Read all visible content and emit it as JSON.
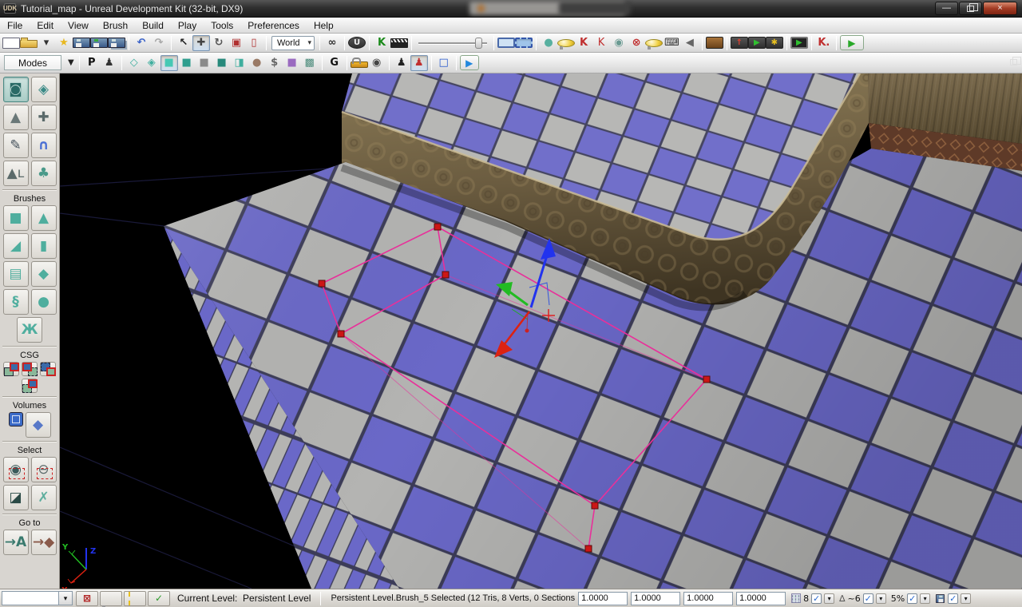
{
  "window": {
    "title": "Tutorial_map - Unreal Development Kit (32-bit, DX9)",
    "badge": "UDK",
    "minimize_glyph": "—",
    "close_glyph": "×"
  },
  "menu": {
    "items": [
      "File",
      "Edit",
      "View",
      "Brush",
      "Build",
      "Play",
      "Tools",
      "Preferences",
      "Help"
    ]
  },
  "toolbar_main": {
    "world_label": "World",
    "groups": [
      [
        {
          "name": "new-map-button",
          "cls": "ic-page"
        },
        {
          "name": "open-map-button",
          "cls": "ic-folder"
        },
        {
          "name": "open-dropdown-arrow",
          "glyph": "▾",
          "color": "#333"
        },
        {
          "name": "favorites-star-icon",
          "glyph": "★",
          "color": "#e8b820"
        },
        {
          "name": "save-button",
          "cls": "ic-floppy"
        },
        {
          "name": "save-as-button",
          "cls": "ic-floppy fl-green"
        },
        {
          "name": "save-all-button",
          "cls": "ic-floppy fl-all"
        }
      ],
      [
        {
          "name": "undo-button",
          "glyph": "↶",
          "color": "#3a62c8",
          "bold": true
        },
        {
          "name": "redo-button",
          "glyph": "↷",
          "color": "#a8a8a8",
          "bold": true
        }
      ],
      [
        {
          "name": "select-tool",
          "glyph": "↖",
          "color": "#222",
          "bold": true
        },
        {
          "name": "translate-tool",
          "glyph": "✚",
          "color": "#444",
          "pressed": true
        },
        {
          "name": "rotate-tool",
          "glyph": "↻",
          "color": "#555",
          "bold": true
        },
        {
          "name": "scale-tool",
          "glyph": "▣",
          "color": "#b03030"
        },
        {
          "name": "scale-nonuniform-tool",
          "glyph": "▯",
          "color": "#b03030"
        }
      ],
      [
        {
          "name": "world-coord-select",
          "widget": "select"
        }
      ],
      [
        {
          "name": "find-actors-button",
          "glyph": "∞",
          "color": "#333",
          "bold": true
        }
      ],
      [
        {
          "name": "content-browser-button",
          "glyph": "U",
          "cls": "chip round"
        }
      ],
      [
        {
          "name": "kismet-button",
          "glyph": "K",
          "color": "#1a8a1a",
          "bold": true
        },
        {
          "name": "matinee-button",
          "cls": "ic-clapper"
        }
      ],
      [
        {
          "name": "camera-speed-slider",
          "widget": "slider"
        }
      ],
      [
        {
          "name": "brush-wireframe-toggle",
          "cls": "ic-bsq"
        },
        {
          "name": "brush-marker-toggle",
          "cls": "ic-bsq dashed",
          "pressed": true
        }
      ],
      [
        {
          "name": "sphere-toggle",
          "glyph": "●",
          "color": "#58b0a0"
        },
        {
          "name": "light-toggle",
          "cls": "ic-bulb"
        },
        {
          "name": "socket-snap-icon",
          "glyph": "K",
          "color": "#c03030",
          "bold": true
        },
        {
          "name": "socket-snap-alt-icon",
          "glyph": "K",
          "color": "#c03030"
        },
        {
          "name": "spheres-toggle",
          "glyph": "◉",
          "color": "#6a9a92"
        },
        {
          "name": "kill-lights-toggle",
          "glyph": "⊗",
          "color": "#c03030",
          "bold": true
        },
        {
          "name": "bulb-m-toggle",
          "cls": "ic-bulb"
        },
        {
          "name": "remote-keyboard-toggle",
          "glyph": "⌨",
          "color": "#333"
        },
        {
          "name": "audio-toggle",
          "glyph": "◀",
          "color": "#666"
        }
      ],
      [
        {
          "name": "build-geometry-button",
          "cls": "chip brown"
        }
      ],
      [
        {
          "name": "deploy-device-button",
          "glyph": "↑",
          "cls": "chip",
          "color": "#e04030",
          "bold": true
        },
        {
          "name": "play-on-device-button",
          "glyph": "▶",
          "cls": "chip",
          "color": "#30c030"
        },
        {
          "name": "device-settings-button",
          "glyph": "✱",
          "cls": "chip",
          "color": "#e8c020"
        }
      ],
      [
        {
          "name": "play-in-viewport-button",
          "glyph": "▶",
          "cls": "chip screen",
          "color": "#30c030"
        }
      ],
      [
        {
          "name": "kismet-debug-button",
          "glyph": "K.",
          "color": "#c03030",
          "bold": true
        }
      ],
      [
        {
          "name": "play-button",
          "glyph": "▶",
          "cls": "playbox",
          "color": "#28a828"
        }
      ]
    ]
  },
  "toolbar_modes": {
    "label": "Modes",
    "caption_arrow": "▼",
    "restore_name": "restore-panes-button",
    "items": [
      {
        "name": "perspective-toggle",
        "glyph": "P",
        "bold": true,
        "color": "#111"
      },
      {
        "name": "camera-pawn-toggle",
        "glyph": "♟",
        "color": "#333"
      },
      {
        "sep": true
      },
      {
        "name": "view-wireframe-icon",
        "glyph": "◇",
        "color": "#3fae9e"
      },
      {
        "name": "view-brushwire-icon",
        "glyph": "◈",
        "color": "#3fae9e"
      },
      {
        "name": "view-unlit-icon",
        "glyph": "■",
        "color": "#46c8b4",
        "pressed": true
      },
      {
        "name": "view-lit-icon",
        "glyph": "■",
        "color": "#2f9e8e"
      },
      {
        "name": "view-detail-lighting-icon",
        "glyph": "■",
        "color": "#8a8a8a"
      },
      {
        "name": "view-lighting-only-icon",
        "glyph": "■",
        "color": "#27897b"
      },
      {
        "name": "view-texture-density-icon",
        "glyph": "◨",
        "color": "#3fae9e"
      },
      {
        "name": "view-shader-complexity-icon",
        "glyph": "●",
        "color": "#9a7a66"
      },
      {
        "name": "view-cost-icon",
        "glyph": "$",
        "color": "#666",
        "bold": true
      },
      {
        "name": "view-lightmap-density-icon",
        "glyph": "■",
        "color": "#9a6ac0"
      },
      {
        "name": "view-reflections-icon",
        "glyph": "▩",
        "color": "#4a8a7a"
      },
      {
        "sep": true
      },
      {
        "name": "game-view-toggle",
        "glyph": "G",
        "bold": true,
        "color": "#111"
      },
      {
        "sep": true
      },
      {
        "name": "lock-viewport-button",
        "cls": "ic-lock"
      },
      {
        "name": "show-flags-eye-icon",
        "glyph": "◉",
        "color": "#444"
      },
      {
        "sep": true
      },
      {
        "name": "possess-pawn-button",
        "glyph": "♟",
        "color": "#222"
      },
      {
        "name": "possess-pawn-red-button",
        "glyph": "♟",
        "color": "#c03030",
        "pressed": true
      },
      {
        "sep": true
      },
      {
        "name": "maximize-viewport-toggle",
        "glyph": "□",
        "color": "#2255cc",
        "bold": true
      },
      {
        "sep": true
      },
      {
        "name": "realtime-play-button",
        "glyph": "▶",
        "cls": "playbox sm",
        "color": "#2288dd"
      }
    ]
  },
  "sidebar": {
    "sections": [
      {
        "items": [
          {
            "name": "mode-camera",
            "glyph": "◙",
            "color": "#2a6a66",
            "selected": true
          },
          {
            "name": "mode-geometry",
            "glyph": "◈",
            "color": "#3a8a86"
          },
          {
            "name": "mode-terrain",
            "glyph": "▲",
            "color": "#6a7878"
          },
          {
            "name": "mode-texture-align",
            "glyph": "✚",
            "color": "#5a6a6a"
          },
          {
            "name": "mode-geometry-edit",
            "glyph": "✎",
            "color": "#44505a"
          },
          {
            "name": "mode-static-mesh",
            "glyph": "∩",
            "color": "#4a6fd4",
            "bold": true
          },
          {
            "name": "mode-landscape",
            "glyph": "▲ʟ",
            "color": "#5a6a6a"
          },
          {
            "name": "mode-foliage",
            "glyph": "♣",
            "color": "#4a9a8a"
          }
        ]
      },
      {
        "label": "Brushes",
        "items": [
          {
            "name": "brush-cube",
            "glyph": "■",
            "color": "#4fae9e"
          },
          {
            "name": "brush-cone",
            "glyph": "▲",
            "color": "#4fae9e"
          },
          {
            "name": "brush-curved-stairs",
            "glyph": "◢",
            "color": "#4fae9e"
          },
          {
            "name": "brush-cylinder",
            "glyph": "▮",
            "color": "#4fae9e"
          },
          {
            "name": "brush-stairs",
            "glyph": "▤",
            "color": "#4fae9e"
          },
          {
            "name": "brush-sheet",
            "glyph": "◆",
            "color": "#4fae9e"
          },
          {
            "name": "brush-spiral-stairs",
            "glyph": "§",
            "color": "#4fae9e",
            "bold": true
          },
          {
            "name": "brush-sphere",
            "glyph": "●",
            "color": "#4fae9e"
          },
          {
            "name": "brush-volumetric",
            "glyph": "Ж",
            "color": "#4fae9e",
            "bold": true
          }
        ]
      },
      {
        "label": "CSG",
        "items": [
          {
            "name": "csg-add-button",
            "cls": "ic-csg csg-add"
          },
          {
            "name": "csg-subtract-button",
            "cls": "ic-csg csg-sub"
          },
          {
            "name": "csg-intersect-button",
            "cls": "ic-csg csg-int"
          },
          {
            "name": "csg-deintersect-button",
            "cls": "ic-csg csg-deint"
          }
        ]
      },
      {
        "label": "Volumes",
        "items": [
          {
            "name": "volume-box-button",
            "cls": "ic-volbox"
          },
          {
            "name": "volume-sphere-button",
            "glyph": "◆",
            "color": "#5878c8"
          }
        ]
      },
      {
        "label": "Select",
        "items": [
          {
            "name": "select-show-button",
            "glyph": "◉",
            "color": "#3a5a5a",
            "cls": "redbox"
          },
          {
            "name": "select-hide-button",
            "glyph": "⊖",
            "color": "#5a6a6a",
            "cls": "redbox"
          },
          {
            "name": "select-invert-button",
            "glyph": "◪",
            "color": "#2a4a46"
          },
          {
            "name": "select-none-button",
            "glyph": "✗",
            "color": "#5fae9e",
            "bold": true
          }
        ]
      },
      {
        "label": "Go to",
        "items": [
          {
            "name": "goto-actor-button",
            "glyph": "→A",
            "color": "#3a7a6e",
            "bold": true
          },
          {
            "name": "goto-builder-brush-button",
            "glyph": "→◆",
            "color": "#8a5a4a",
            "bold": true
          }
        ]
      }
    ]
  },
  "viewport": {
    "colors": {
      "checker_blue": "#6a68c8",
      "checker_gray": "#b4b4b2",
      "checker_grout": "#3c3c58",
      "selection_pink": "#e8309a",
      "vertex_red": "#cc1616",
      "axis_x_red": "#dd2211",
      "axis_y_green": "#22bb22",
      "axis_z_blue": "#2233ee",
      "grid_line": "#191938",
      "trim_brown": "#77674a",
      "wall_wood": "#6b5d42",
      "band_red": "#5e3a28"
    },
    "axis_labels": {
      "x": "X",
      "y": "Y",
      "z": "Z"
    },
    "selected_brush": "Brush_5"
  },
  "status_bar": {
    "dropdown_arrow": "▾",
    "buttons": [
      {
        "name": "hide-builder-brush-button",
        "glyph": "⊠",
        "color": "#b02020",
        "bold": true
      },
      {
        "name": "bulb-status-button",
        "cls": "ic-bulb"
      },
      {
        "name": "paths-status-button",
        "cls": "ic-road"
      },
      {
        "name": "package-check-button",
        "glyph": "✓",
        "color": "#2a9a2a",
        "bold": true
      }
    ],
    "current_level_label": "Current Level:",
    "current_level_value": "Persistent Level",
    "selection_text": "Persistent Level.Brush_5 Selected (12 Tris, 8 Verts, 0 Sections",
    "fields": [
      "1.0000",
      "1.0000",
      "1.0000",
      "1.0000"
    ],
    "check_glyph": "✓",
    "toggles": [
      {
        "name": "drag-grid-toggle",
        "icon_cls": "ic-grid",
        "label": "8"
      },
      {
        "name": "rotation-grid-toggle",
        "glyph": "∆",
        "label": "~6"
      },
      {
        "name": "scale-grid-toggle",
        "label": "5%"
      },
      {
        "name": "autosave-toggle",
        "icon_cls": "ic-floppy sm",
        "label": ""
      }
    ]
  }
}
